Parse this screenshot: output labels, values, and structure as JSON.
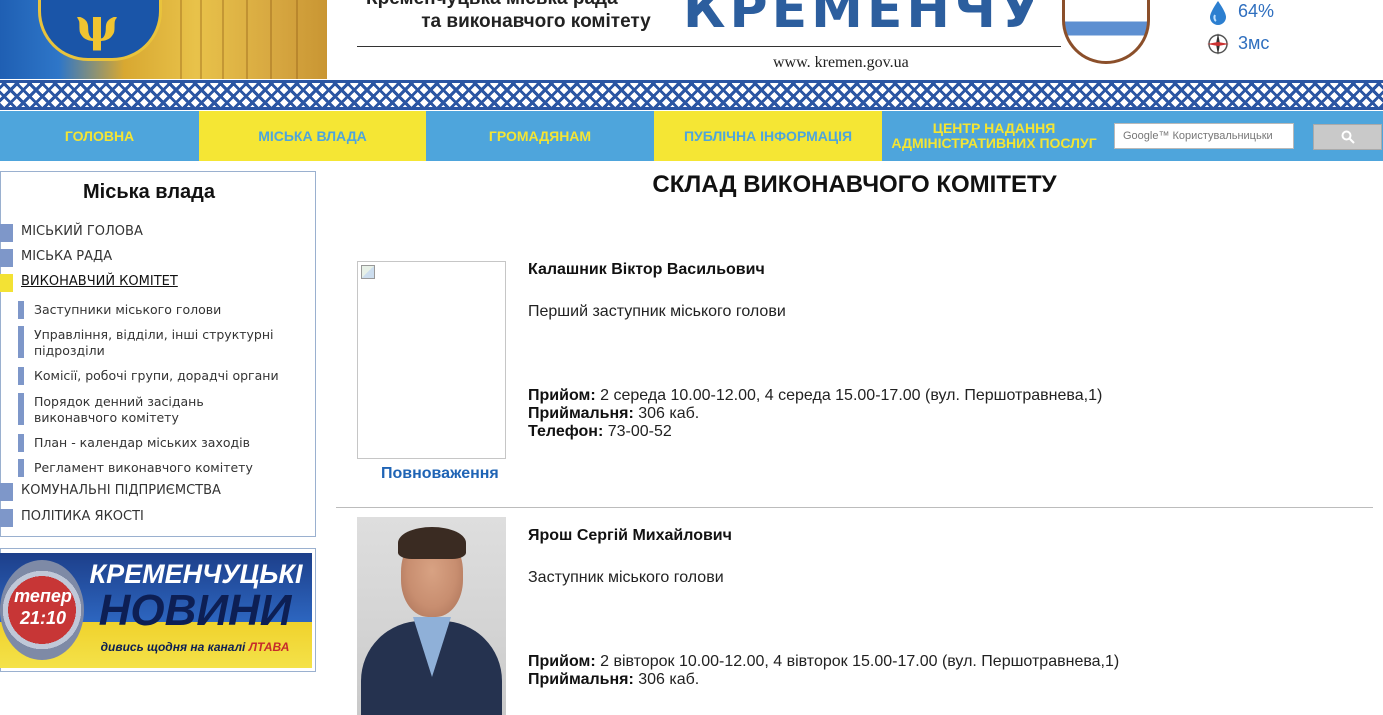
{
  "header": {
    "line1": "Кременчуцька міська рада",
    "line2": "та виконавчого комітету",
    "city_word": "КРЕМЕНЧУК",
    "url": "www. kremen.gov.ua",
    "humidity": "64%",
    "wind": "3мс"
  },
  "nav": {
    "items": [
      {
        "label": "ГОЛОВНА"
      },
      {
        "label": "МІСЬКА ВЛАДА"
      },
      {
        "label": "ГРОМАДЯНАМ"
      },
      {
        "label": "ПУБЛІЧНА ІНФОРМАЦІЯ"
      },
      {
        "label": "ЦЕНТР НАДАННЯ АДМІНІСТРАТИВНИХ ПОСЛУГ"
      }
    ],
    "search_placeholder": "Google™ Користувальницьки"
  },
  "sidebar": {
    "title": "Міська влада",
    "items": [
      {
        "label": "МІСЬКИЙ ГОЛОВА"
      },
      {
        "label": "МІСЬКА РАДА"
      },
      {
        "label": "ВИКОНАВЧИЙ КОМІТЕТ"
      },
      {
        "label": "КОМУНАЛЬНІ ПІДПРИЄМСТВА"
      },
      {
        "label": "ПОЛІТИКА ЯКОСТІ"
      }
    ],
    "subitems": [
      {
        "label": "Заступники міського голови"
      },
      {
        "label": "Управління, відділи, інші структурні підрозділи"
      },
      {
        "label": "Комісії, робочі групи, дорадчі органи"
      },
      {
        "label": "Порядок денний засідань виконавчого комітету"
      },
      {
        "label": "План - календар міських заходів"
      },
      {
        "label": "Регламент виконавчого комітету"
      }
    ]
  },
  "banner": {
    "now": "тепер",
    "time": "21:10",
    "title1": "КРЕМЕНЧУЦЬКІ",
    "title2": "НОВИНИ",
    "sub": "дивись щодня на каналі",
    "channel": "ЛТАВА"
  },
  "main": {
    "title": "СКЛАД ВИКОНАВЧОГО КОМІТЕТУ",
    "people": [
      {
        "name": "Калашник Віктор Васильович",
        "role": "Перший заступник міського голови",
        "reception_label": "Прийом:",
        "reception": "2 середа 10.00-12.00, 4 середа 15.00-17.00 (вул. Першотравнева,1)",
        "office_label": "Приймальня:",
        "office": "306 каб.",
        "phone_label": "Телефон:",
        "phone": "73-00-52",
        "powers": "Повноваження"
      },
      {
        "name": "Ярош Сергій Михайлович",
        "role": "Заступник міського голови",
        "reception_label": "Прийом:",
        "reception": "2 вівторок 10.00-12.00, 4 вівторок 15.00-17.00 (вул. Першотравнева,1)",
        "office_label": "Приймальня:",
        "office": "306 каб."
      }
    ]
  }
}
